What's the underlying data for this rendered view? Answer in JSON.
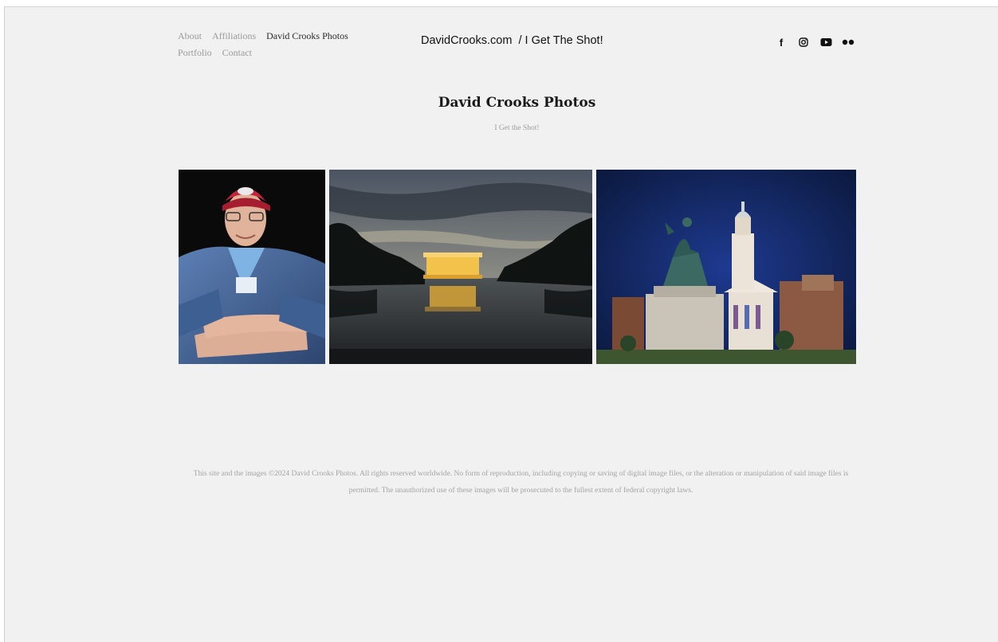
{
  "header": {
    "nav": [
      {
        "label": "About",
        "active": false
      },
      {
        "label": "Affiliations",
        "active": false
      },
      {
        "label": "David Crooks Photos",
        "active": true
      },
      {
        "label": "Portfolio",
        "active": false
      },
      {
        "label": "Contact",
        "active": false
      }
    ],
    "site_title": "DavidCrooks.com  / I Get The Shot!",
    "social": [
      {
        "icon": "facebook-icon",
        "glyph": "f"
      },
      {
        "icon": "instagram-icon"
      },
      {
        "icon": "youtube-icon"
      },
      {
        "icon": "flickr-icon"
      }
    ]
  },
  "main": {
    "title": "David Crooks Photos",
    "subtitle": "I Get the Shot!",
    "gallery": [
      {
        "subject": "portrait-red-cap"
      },
      {
        "subject": "lincoln-memorial-reflecting-pool-dusk"
      },
      {
        "subject": "equestrian-statue-church-night"
      }
    ]
  },
  "footer": {
    "copyright": "This site and the images ©2024 David Crooks Photos. All rights reserved worldwide. No form of reproduction, including copying or saving of digital image files, or the alteration or manipulation of said image files is permitted. The unauthorized use of these images will be prosecuted to the fullest extent of federal copyright laws."
  },
  "colors": {
    "background": "#f1f1f1",
    "nav_inactive": "#9a9a9a",
    "nav_active": "#2a2a2a",
    "footer_text": "#a3a3a3"
  }
}
